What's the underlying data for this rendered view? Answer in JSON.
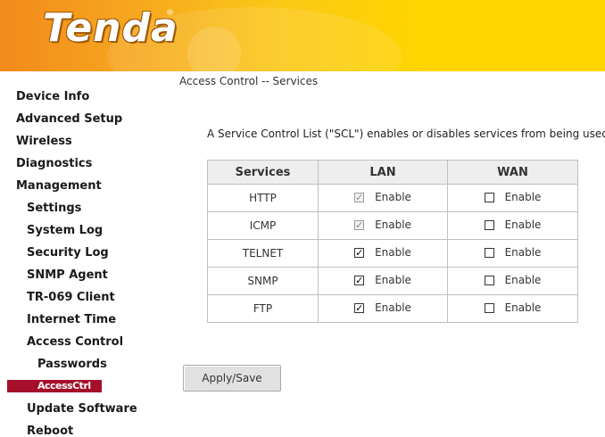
{
  "header": {
    "logo_text": "Tenda",
    "logo_mark": "®"
  },
  "sidebar": {
    "items": [
      {
        "label": "Device Info",
        "level": 0
      },
      {
        "label": "Advanced Setup",
        "level": 0
      },
      {
        "label": "Wireless",
        "level": 0
      },
      {
        "label": "Diagnostics",
        "level": 0
      },
      {
        "label": "Management",
        "level": 0
      },
      {
        "label": "Settings",
        "level": 1
      },
      {
        "label": "System Log",
        "level": 1
      },
      {
        "label": "Security Log",
        "level": 1
      },
      {
        "label": "SNMP Agent",
        "level": 1
      },
      {
        "label": "TR-069 Client",
        "level": 1
      },
      {
        "label": "Internet Time",
        "level": 1
      },
      {
        "label": "Access Control",
        "level": 1
      },
      {
        "label": "Passwords",
        "level": 2
      },
      {
        "label": "AccessCtrl",
        "level": 2,
        "active": true
      },
      {
        "label": "Update Software",
        "level": 1
      },
      {
        "label": "Reboot",
        "level": 1
      }
    ],
    "active_color": "#a50f2a"
  },
  "main": {
    "breadcrumb": "Access Control -- Services",
    "description": "A Service Control List (\"SCL\") enables or disables services from being used",
    "table": {
      "headers": [
        "Services",
        "LAN",
        "WAN"
      ],
      "enable_label": "Enable",
      "rows": [
        {
          "service": "HTTP",
          "lan_checked": true,
          "lan_disabled": true,
          "wan_checked": false
        },
        {
          "service": "ICMP",
          "lan_checked": true,
          "lan_disabled": true,
          "wan_checked": false
        },
        {
          "service": "TELNET",
          "lan_checked": true,
          "lan_disabled": false,
          "wan_checked": false
        },
        {
          "service": "SNMP",
          "lan_checked": true,
          "lan_disabled": false,
          "wan_checked": false
        },
        {
          "service": "FTP",
          "lan_checked": true,
          "lan_disabled": false,
          "wan_checked": false
        }
      ]
    },
    "apply_button": "Apply/Save"
  }
}
